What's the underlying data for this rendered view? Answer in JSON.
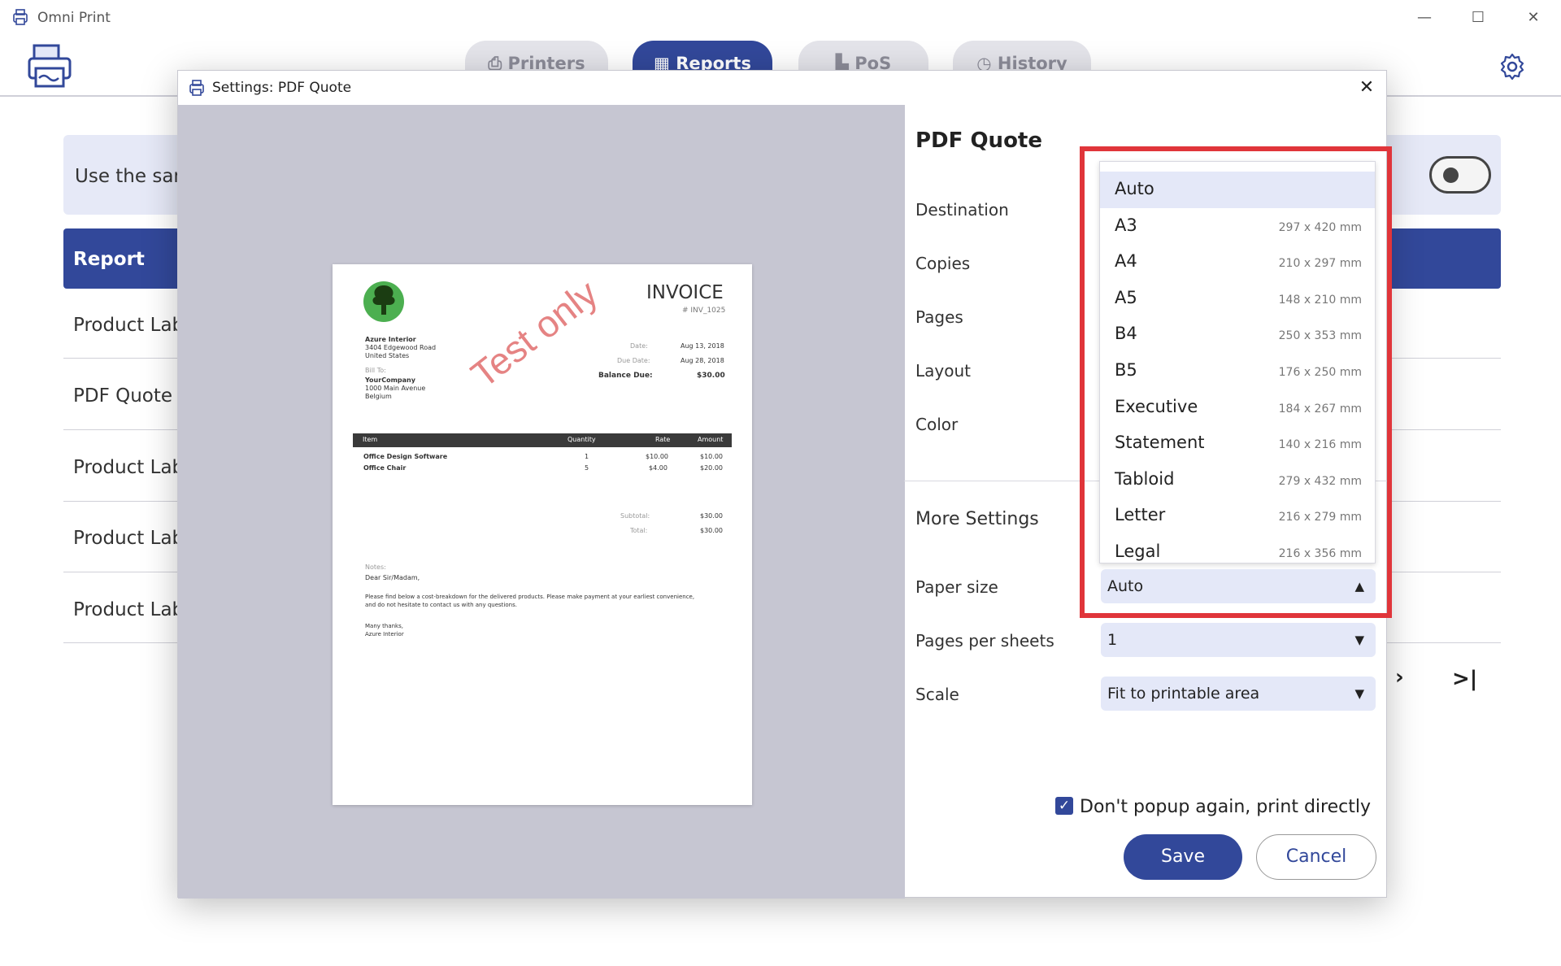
{
  "app": {
    "title": "Omni Print",
    "window_controls": {
      "minimize": "—",
      "maximize": "☐",
      "close": "✕"
    }
  },
  "tabs": [
    {
      "label": "Printers",
      "icon": "printer-icon",
      "active": false
    },
    {
      "label": "Reports",
      "icon": "grid-icon",
      "active": true
    },
    {
      "label": "PoS",
      "icon": "pos-icon",
      "active": false
    },
    {
      "label": "History",
      "icon": "history-icon",
      "active": false
    }
  ],
  "background": {
    "banner_text": "Use the san",
    "table_header": "Report",
    "rows": [
      "Product Lab",
      "PDF Quote",
      "Product Lab",
      "Product Lab",
      "Product Lab"
    ],
    "pager_next": "›",
    "pager_last": ">|"
  },
  "dialog": {
    "title": "Settings: PDF Quote",
    "close": "✕",
    "heading": "PDF Quote",
    "labels": {
      "destination": "Destination",
      "copies": "Copies",
      "pages": "Pages",
      "layout": "Layout",
      "color": "Color",
      "more_settings": "More Settings",
      "paper_size": "Paper size",
      "pages_per_sheets": "Pages per sheets",
      "scale": "Scale"
    },
    "values": {
      "paper_size": "Auto",
      "pages_per_sheets": "1",
      "scale": "Fit to printable area"
    },
    "paper_size_options": [
      {
        "name": "Auto",
        "dims": ""
      },
      {
        "name": "A3",
        "dims": "297 x 420 mm"
      },
      {
        "name": "A4",
        "dims": "210 x 297 mm"
      },
      {
        "name": "A5",
        "dims": "148 x 210 mm"
      },
      {
        "name": "B4",
        "dims": "250 x 353 mm"
      },
      {
        "name": "B5",
        "dims": "176 x 250 mm"
      },
      {
        "name": "Executive",
        "dims": "184 x 267 mm"
      },
      {
        "name": "Statement",
        "dims": "140 x 216 mm"
      },
      {
        "name": "Tabloid",
        "dims": "279 x 432 mm"
      },
      {
        "name": "Letter",
        "dims": "216 x 279 mm"
      },
      {
        "name": "Legal",
        "dims": "216 x 356 mm"
      }
    ],
    "dont_popup": "Don't popup again, print directly",
    "dont_popup_checked": true,
    "save": "Save",
    "cancel": "Cancel"
  },
  "invoice": {
    "title": "INVOICE",
    "number": "# INV_1025",
    "from": [
      "Azure Interior",
      "3404 Edgewood Road",
      "United States"
    ],
    "bill_to_label": "Bill To:",
    "bill_to": [
      "YourCompany",
      "1000 Main Avenue",
      "Belgium"
    ],
    "date_label": "Date:",
    "date": "Aug 13, 2018",
    "due_label": "Due Date:",
    "due": "Aug 28, 2018",
    "balance_label": "Balance Due:",
    "balance": "$30.00",
    "watermark": "Test only",
    "columns": [
      "Item",
      "Quantity",
      "Rate",
      "Amount"
    ],
    "lines": [
      {
        "item": "Office Design Software",
        "qty": "1",
        "rate": "$10.00",
        "amount": "$10.00"
      },
      {
        "item": "Office Chair",
        "qty": "5",
        "rate": "$4.00",
        "amount": "$20.00"
      }
    ],
    "subtotal_label": "Subtotal:",
    "subtotal": "$30.00",
    "total_label": "Total:",
    "total": "$30.00",
    "notes_label": "Notes:",
    "notes": [
      "Dear Sir/Madam,",
      "Please find below a cost-breakdown for the delivered products. Please make payment at your earliest convenience,",
      "and do not hesitate to contact us with any questions.",
      "Many thanks,",
      "Azure Interior"
    ]
  },
  "colors": {
    "accent": "#32489a",
    "highlight": "#e0353a",
    "select_bg": "#e4e8f8"
  }
}
